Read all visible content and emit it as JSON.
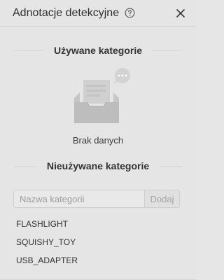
{
  "header": {
    "title": "Adnotacje detekcyjne",
    "help_icon": "question-circle-icon",
    "close_icon": "close-icon"
  },
  "used": {
    "title": "Używane kategorie",
    "empty_text": "Brak danych",
    "empty_icon": "empty-inbox-icon"
  },
  "unused": {
    "title": "Nieużywane kategorie",
    "input_placeholder": "Nazwa kategorii",
    "input_value": "",
    "add_label": "Dodaj",
    "categories": [
      "FLASHLIGHT",
      "SQUISHY_TOY",
      "USB_ADAPTER"
    ]
  },
  "colors": {
    "background": "#e5e5e5",
    "divider": "#d6d6d6",
    "text": "#333333"
  }
}
